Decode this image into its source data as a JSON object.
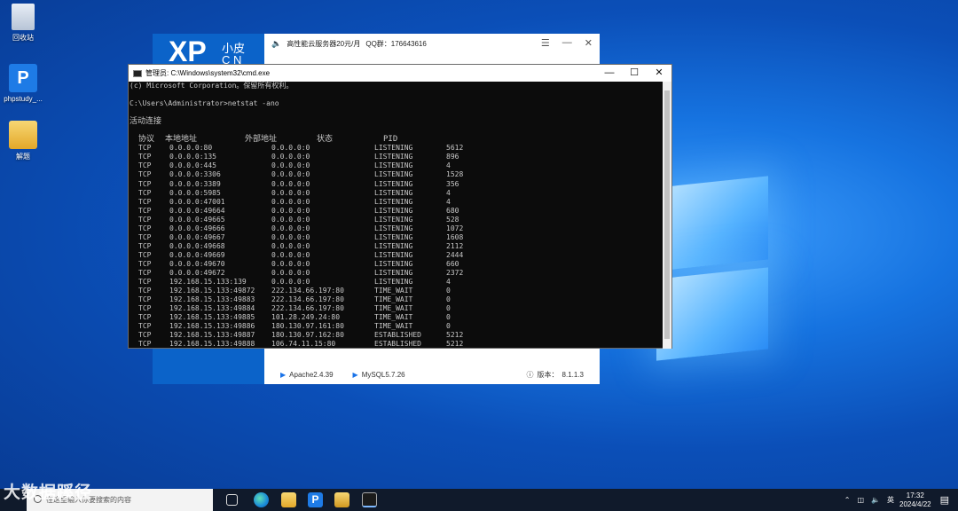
{
  "desktop": {
    "icons": [
      {
        "label": "回收站",
        "icon": "recycle-bin-icon"
      },
      {
        "label": "phpstudy_...",
        "icon": "phpstudy-icon"
      },
      {
        "label": "解题",
        "icon": "folder-icon"
      }
    ]
  },
  "phpstudy": {
    "brand": "XP",
    "brand_sub1": "小皮",
    "brand_sub2": "C N",
    "announcement": "高性能云服务器20元/月",
    "qq": "QQ群：176643616",
    "services": [
      "Apache2.4.39",
      "MySQL5.7.26"
    ],
    "version_label": "版本：",
    "version": "8.1.1.3"
  },
  "cmd": {
    "title": "管理员: C:\\Windows\\system32\\cmd.exe",
    "copyright": "(c) Microsoft Corporation。保留所有权利。",
    "prompt": "C:\\Users\\Administrator>netstat -ano",
    "section": "活动连接",
    "headers": [
      "协议",
      "本地地址",
      "外部地址",
      "状态",
      "PID"
    ],
    "rows": [
      [
        "TCP",
        "0.0.0.0:80",
        "0.0.0.0:0",
        "LISTENING",
        "5612"
      ],
      [
        "TCP",
        "0.0.0.0:135",
        "0.0.0.0:0",
        "LISTENING",
        "896"
      ],
      [
        "TCP",
        "0.0.0.0:445",
        "0.0.0.0:0",
        "LISTENING",
        "4"
      ],
      [
        "TCP",
        "0.0.0.0:3306",
        "0.0.0.0:0",
        "LISTENING",
        "1528"
      ],
      [
        "TCP",
        "0.0.0.0:3389",
        "0.0.0.0:0",
        "LISTENING",
        "356"
      ],
      [
        "TCP",
        "0.0.0.0:5985",
        "0.0.0.0:0",
        "LISTENING",
        "4"
      ],
      [
        "TCP",
        "0.0.0.0:47001",
        "0.0.0.0:0",
        "LISTENING",
        "4"
      ],
      [
        "TCP",
        "0.0.0.0:49664",
        "0.0.0.0:0",
        "LISTENING",
        "680"
      ],
      [
        "TCP",
        "0.0.0.0:49665",
        "0.0.0.0:0",
        "LISTENING",
        "528"
      ],
      [
        "TCP",
        "0.0.0.0:49666",
        "0.0.0.0:0",
        "LISTENING",
        "1072"
      ],
      [
        "TCP",
        "0.0.0.0:49667",
        "0.0.0.0:0",
        "LISTENING",
        "1608"
      ],
      [
        "TCP",
        "0.0.0.0:49668",
        "0.0.0.0:0",
        "LISTENING",
        "2112"
      ],
      [
        "TCP",
        "0.0.0.0:49669",
        "0.0.0.0:0",
        "LISTENING",
        "2444"
      ],
      [
        "TCP",
        "0.0.0.0:49670",
        "0.0.0.0:0",
        "LISTENING",
        "660"
      ],
      [
        "TCP",
        "0.0.0.0:49672",
        "0.0.0.0:0",
        "LISTENING",
        "2372"
      ],
      [
        "TCP",
        "192.168.15.133:139",
        "0.0.0.0:0",
        "LISTENING",
        "4"
      ],
      [
        "TCP",
        "192.168.15.133:49872",
        "222.134.66.197:80",
        "TIME_WAIT",
        "0"
      ],
      [
        "TCP",
        "192.168.15.133:49883",
        "222.134.66.197:80",
        "TIME_WAIT",
        "0"
      ],
      [
        "TCP",
        "192.168.15.133:49884",
        "222.134.66.197:80",
        "TIME_WAIT",
        "0"
      ],
      [
        "TCP",
        "192.168.15.133:49885",
        "101.28.249.24:80",
        "TIME_WAIT",
        "0"
      ],
      [
        "TCP",
        "192.168.15.133:49886",
        "180.130.97.161:80",
        "TIME_WAIT",
        "0"
      ],
      [
        "TCP",
        "192.168.15.133:49887",
        "180.130.97.162:80",
        "ESTABLISHED",
        "5212"
      ],
      [
        "TCP",
        "192.168.15.133:49888",
        "106.74.11.15:80",
        "ESTABLISHED",
        "5212"
      ]
    ]
  },
  "taskbar": {
    "search_placeholder": "在这里输入你要搜索的内容",
    "ime": "英",
    "time": "17:32",
    "date": "2024/4/22"
  },
  "watermark": "大数据蹊径",
  "colors": {
    "accent": "#0b63c9",
    "taskbar": "#101a2b",
    "console_bg": "#0c0c0c"
  }
}
